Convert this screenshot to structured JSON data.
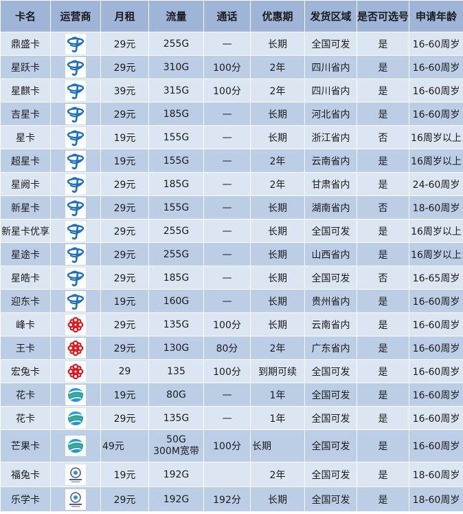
{
  "headers": [
    "卡名",
    "运营商",
    "月租",
    "流量",
    "通话",
    "优惠期",
    "发货区域",
    "是否可选号",
    "申请年龄"
  ],
  "rows": [
    {
      "name": "鼎盛卡",
      "carrier": "telecom",
      "fee": "29元",
      "data": "255G",
      "call": "—",
      "period": "长期",
      "region": "全国可发",
      "choose": "是",
      "age": "16-60周岁"
    },
    {
      "name": "星跃卡",
      "carrier": "telecom",
      "fee": "29元",
      "data": "310G",
      "call": "100分",
      "period": "2年",
      "region": "四川省内",
      "choose": "是",
      "age": "16-60周岁"
    },
    {
      "name": "星麒卡",
      "carrier": "telecom",
      "fee": "39元",
      "data": "315G",
      "call": "100分",
      "period": "2年",
      "region": "四川省内",
      "choose": "是",
      "age": "16-60周岁"
    },
    {
      "name": "吉星卡",
      "carrier": "telecom",
      "fee": "29元",
      "data": "185G",
      "call": "—",
      "period": "长期",
      "region": "河北省内",
      "choose": "是",
      "age": "16-60周岁"
    },
    {
      "name": "星卡",
      "carrier": "telecom",
      "fee": "19元",
      "data": "155G",
      "call": "—",
      "period": "长期",
      "region": "浙江省内",
      "choose": "否",
      "age": "16周岁以上"
    },
    {
      "name": "超星卡",
      "carrier": "telecom",
      "fee": "19元",
      "data": "155G",
      "call": "—",
      "period": "2年",
      "region": "云南省内",
      "choose": "是",
      "age": "16周岁以上"
    },
    {
      "name": "星阙卡",
      "carrier": "telecom",
      "fee": "29元",
      "data": "185G",
      "call": "—",
      "period": "2年",
      "region": "甘肃省内",
      "choose": "是",
      "age": "24-60周岁"
    },
    {
      "name": "新星卡",
      "carrier": "telecom",
      "fee": "29元",
      "data": "155G",
      "call": "—",
      "period": "长期",
      "region": "湖南省内",
      "choose": "否",
      "age": "18-60周岁"
    },
    {
      "name": "新星卡优享",
      "carrier": "telecom",
      "fee": "29元",
      "data": "255G",
      "call": "—",
      "period": "长期",
      "region": "全国可发",
      "choose": "是",
      "age": "16周岁以上"
    },
    {
      "name": "星途卡",
      "carrier": "telecom",
      "fee": "29元",
      "data": "255G",
      "call": "—",
      "period": "长期",
      "region": "山西省内",
      "choose": "是",
      "age": "16周岁以上"
    },
    {
      "name": "星皓卡",
      "carrier": "telecom",
      "fee": "29元",
      "data": "185G",
      "call": "—",
      "period": "长期",
      "region": "全国可发",
      "choose": "否",
      "age": "16-65周岁"
    },
    {
      "name": "迎东卡",
      "carrier": "telecom",
      "fee": "19元",
      "data": "160G",
      "call": "—",
      "period": "长期",
      "region": "贵州省内",
      "choose": "是",
      "age": "16-60周岁"
    },
    {
      "name": "峰卡",
      "carrier": "unicom",
      "fee": "29元",
      "data": "135G",
      "call": "100分",
      "period": "长期",
      "region": "云南省内",
      "choose": "是",
      "age": "16-60周岁"
    },
    {
      "name": "王卡",
      "carrier": "unicom",
      "fee": "29元",
      "data": "130G",
      "call": "80分",
      "period": "2年",
      "region": "广东省内",
      "choose": "是",
      "age": "16-60周岁"
    },
    {
      "name": "宏兔卡",
      "carrier": "unicom",
      "fee": "29",
      "data": "135",
      "call": "100分",
      "period": "到期可续",
      "region": "全国可发",
      "choose": "是",
      "age": "16-60周岁"
    },
    {
      "name": "花卡",
      "carrier": "mobile",
      "fee": "19元",
      "data": "80G",
      "call": "—",
      "period": "1年",
      "region": "全国可发",
      "choose": "是",
      "age": "16-60周岁"
    },
    {
      "name": "花卡",
      "carrier": "mobile",
      "fee": "29元",
      "data": "135G",
      "call": "—",
      "period": "1年",
      "region": "全国可发",
      "choose": "是",
      "age": "16-60周岁"
    },
    {
      "name": "芒果卡",
      "carrier": "mobile",
      "fee": "49元",
      "data_line1": "50G",
      "data_line2": "300M宽带",
      "call": "100分",
      "period": "长期",
      "region": "全国可发",
      "choose": "是",
      "age": "16-60周岁"
    },
    {
      "name": "福兔卡",
      "carrier": "broadnet",
      "fee": "19元",
      "data": "192G",
      "call": "",
      "period": "2年",
      "region": "全国可发",
      "choose": "是",
      "age": "18-60周岁"
    },
    {
      "name": "乐学卡",
      "carrier": "broadnet",
      "fee": "29元",
      "data": "192G",
      "call": "192分",
      "period": "长期",
      "region": "全国可发",
      "choose": "是",
      "age": "18-60周岁"
    }
  ],
  "colors": {
    "telecom": "#1a6fc4",
    "unicom": "#e4141b",
    "mobile": "#1c9bd6",
    "mobile_green": "#57b646",
    "broadnet": "#4a5a8a"
  }
}
